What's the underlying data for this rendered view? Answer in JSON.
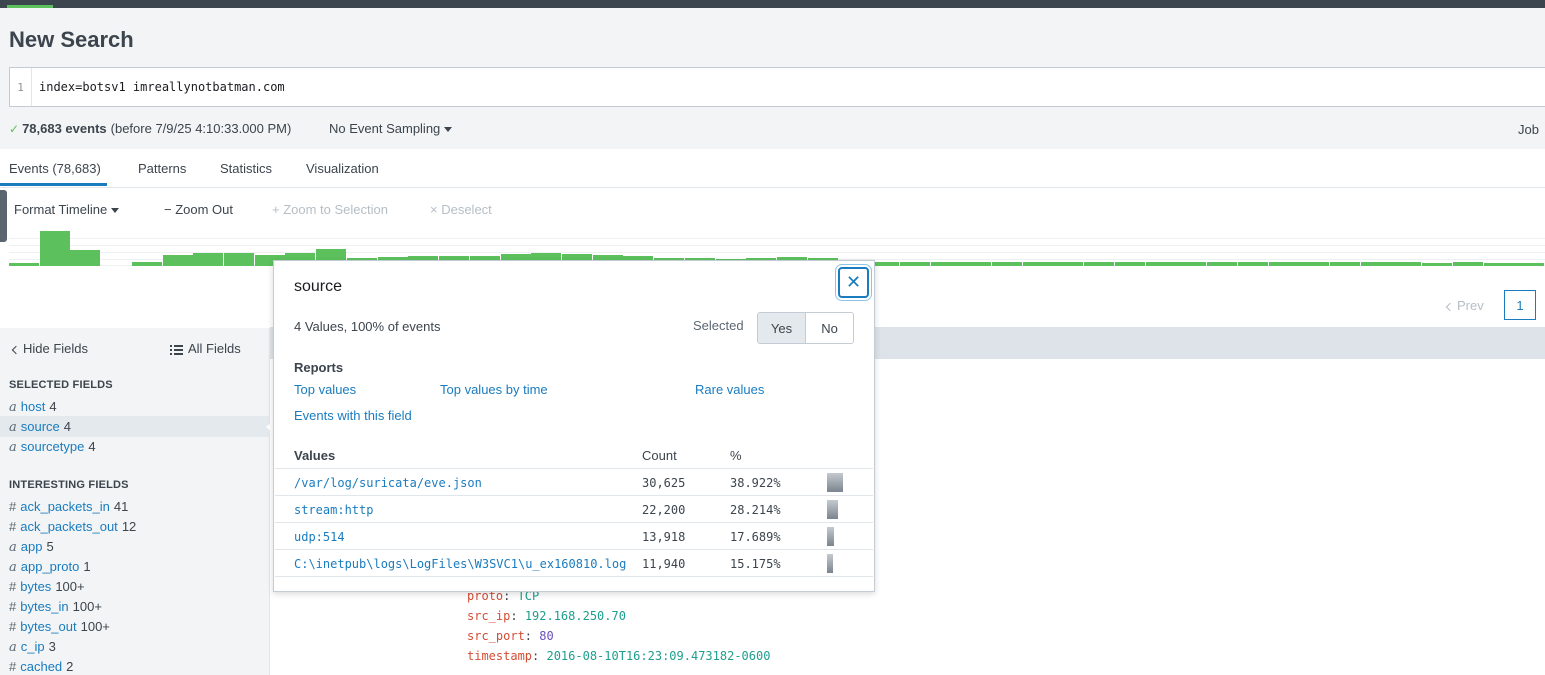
{
  "page": {
    "title": "New Search"
  },
  "search": {
    "line_number": "1",
    "query": "index=botsv1 imreallynotbatman.com"
  },
  "status": {
    "check": "✓",
    "events": "78,683 events",
    "before": "(before 7/9/25 4:10:33.000 PM)",
    "sampling": "No Event Sampling",
    "job": "Job"
  },
  "tabs": [
    {
      "label": "Events (78,683)",
      "active": true
    },
    {
      "label": "Patterns"
    },
    {
      "label": "Statistics"
    },
    {
      "label": "Visualization"
    }
  ],
  "timeline_toolbar": {
    "format": "Format Timeline",
    "zoom_out": "− Zoom Out",
    "zoom_selection": "+ Zoom to Selection",
    "deselect": "× Deselect"
  },
  "timeline_bars": [
    0.08,
    1.0,
    0.45,
    0,
    0.1,
    0.3,
    0.38,
    0.36,
    0.32,
    0.38,
    0.48,
    0.22,
    0.25,
    0.28,
    0.28,
    0.28,
    0.34,
    0.36,
    0.34,
    0.3,
    0.28,
    0.24,
    0.22,
    0.2,
    0.24,
    0.26,
    0.22,
    0.16,
    0.12,
    0.12,
    0.12,
    0.12,
    0.12,
    0.12,
    0.12,
    0.12,
    0.12,
    0.12,
    0.12,
    0.12,
    0.1,
    0.12,
    0.1,
    0.1,
    0.1,
    0.12,
    0.08,
    0.1,
    0.08,
    0.08
  ],
  "pagination": {
    "prev": "Prev",
    "page": "1"
  },
  "sidebar": {
    "hide_fields": "Hide Fields",
    "all_fields": "All Fields",
    "selected_header": "SELECTED FIELDS",
    "selected": [
      {
        "type": "a",
        "name": "host",
        "count": "4"
      },
      {
        "type": "a",
        "name": "source",
        "count": "4"
      },
      {
        "type": "a",
        "name": "sourcetype",
        "count": "4"
      }
    ],
    "interesting_header": "INTERESTING FIELDS",
    "interesting": [
      {
        "type": "#",
        "name": "ack_packets_in",
        "count": "41"
      },
      {
        "type": "#",
        "name": "ack_packets_out",
        "count": "12"
      },
      {
        "type": "a",
        "name": "app",
        "count": "5"
      },
      {
        "type": "a",
        "name": "app_proto",
        "count": "1"
      },
      {
        "type": "#",
        "name": "bytes",
        "count": "100+"
      },
      {
        "type": "#",
        "name": "bytes_in",
        "count": "100+"
      },
      {
        "type": "#",
        "name": "bytes_out",
        "count": "100+"
      },
      {
        "type": "a",
        "name": "c_ip",
        "count": "3"
      },
      {
        "type": "#",
        "name": "cached",
        "count": "2"
      }
    ]
  },
  "event": [
    {
      "key": "proto",
      "value": "TCP",
      "style": "v1"
    },
    {
      "key": "src_ip",
      "value": "192.168.250.70",
      "style": "v1"
    },
    {
      "key": "src_port",
      "value": "80",
      "style": "v2"
    },
    {
      "key": "timestamp",
      "value": "2016-08-10T16:23:09.473182-0600",
      "style": "v1"
    }
  ],
  "popup": {
    "title": "source",
    "close": "✕",
    "meta": "4 Values, 100% of events",
    "selected_label": "Selected",
    "yes": "Yes",
    "no": "No",
    "reports_header": "Reports",
    "reports": {
      "top_values": "Top values",
      "top_by_time": "Top values by time",
      "rare": "Rare values",
      "events_with": "Events with this field"
    },
    "table_headers": {
      "values": "Values",
      "count": "Count",
      "pct": "%"
    },
    "rows": [
      {
        "value": "/var/log/suricata/eve.json",
        "count": "30,625",
        "pct": "38.922%",
        "frac": 0.38922
      },
      {
        "value": "stream:http",
        "count": "22,200",
        "pct": "28.214%",
        "frac": 0.28214
      },
      {
        "value": "udp:514",
        "count": "13,918",
        "pct": "17.689%",
        "frac": 0.17689
      },
      {
        "value": "C:\\inetpub\\logs\\LogFiles\\W3SVC1\\u_ex160810.log",
        "count": "11,940",
        "pct": "15.175%",
        "frac": 0.15175
      }
    ]
  }
}
